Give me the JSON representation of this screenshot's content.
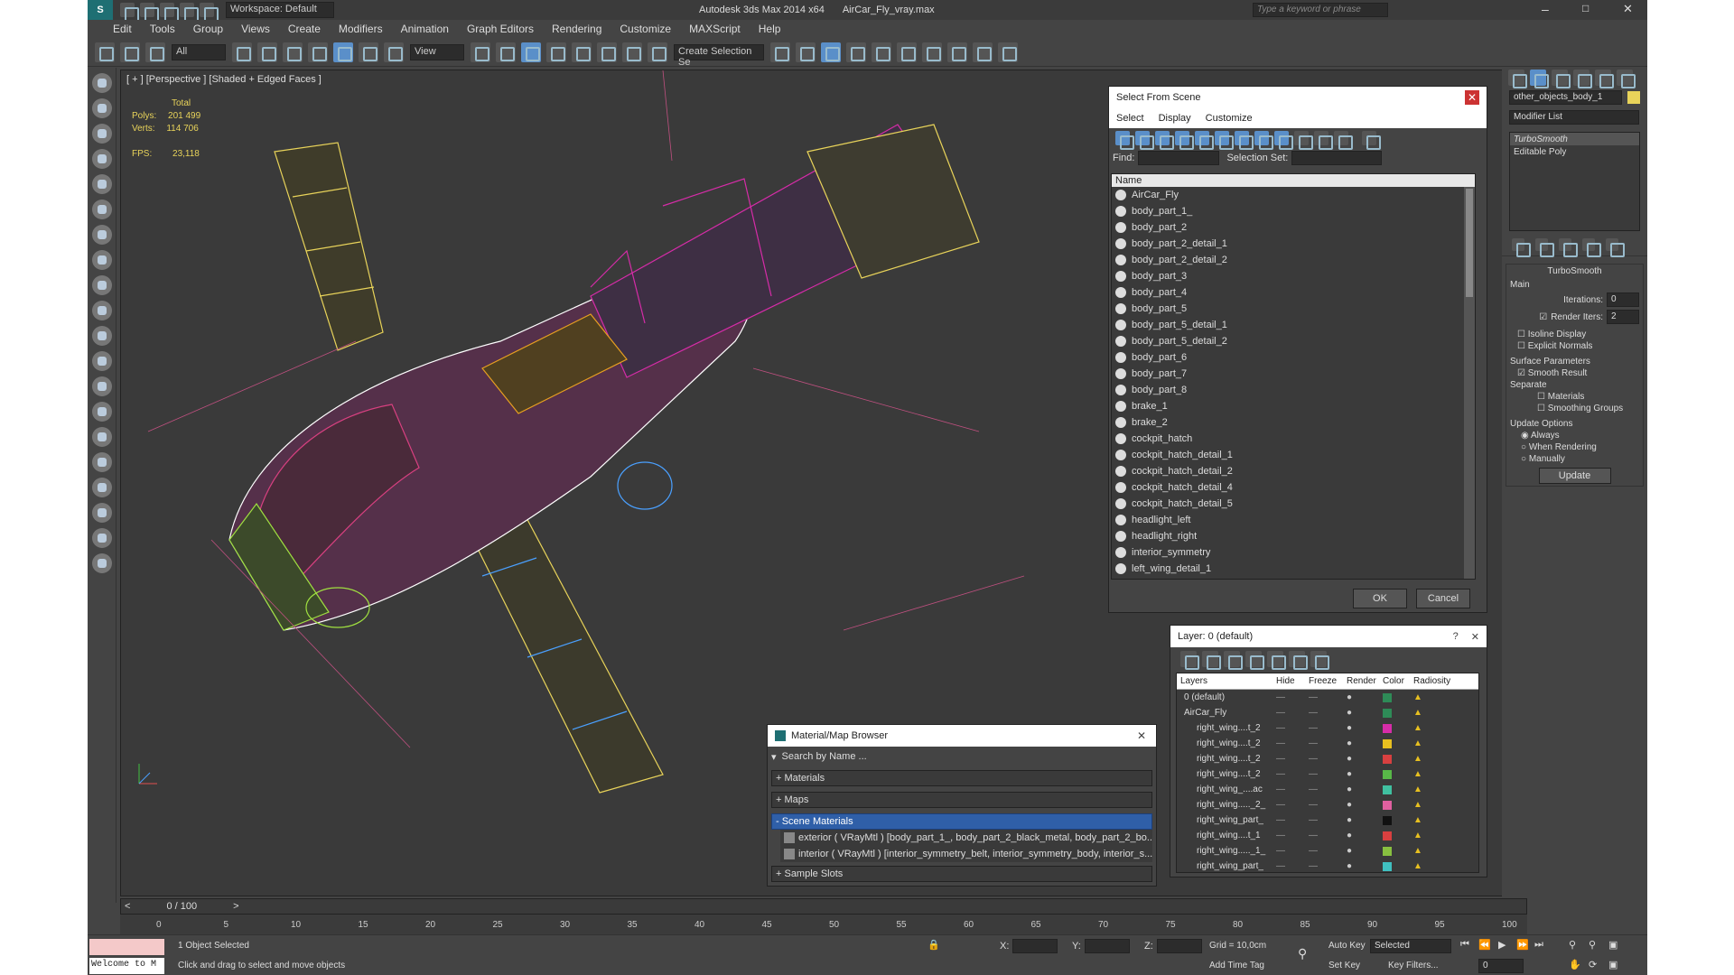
{
  "titlebar": {
    "workspace": "Workspace: Default",
    "app_title": "Autodesk 3ds Max  2014 x64",
    "file_title": "AirCar_Fly_vray.max",
    "search_placeholder": "Type a keyword or phrase"
  },
  "menu": [
    "Edit",
    "Tools",
    "Group",
    "Views",
    "Create",
    "Modifiers",
    "Animation",
    "Graph Editors",
    "Rendering",
    "Customize",
    "MAXScript",
    "Help"
  ],
  "toolbar": {
    "filter": "All",
    "view_mode": "View",
    "selection_set": "Create Selection Se"
  },
  "viewport": {
    "label": "[ + ] [Perspective ] [Shaded + Edged Faces ]",
    "stats_total": "Total",
    "polys_label": "Polys:",
    "polys_value": "201 499",
    "verts_label": "Verts:",
    "verts_value": "114 706",
    "fps_label": "FPS:",
    "fps_value": "23,118"
  },
  "select_scene": {
    "title": "Select From Scene",
    "menus": [
      "Select",
      "Display",
      "Customize"
    ],
    "find_label": "Find:",
    "selection_set_label": "Selection Set:",
    "column_name": "Name",
    "items": [
      "AirCar_Fly",
      "body_part_1_",
      "body_part_2",
      "body_part_2_detail_1",
      "body_part_2_detail_2",
      "body_part_3",
      "body_part_4",
      "body_part_5",
      "body_part_5_detail_1",
      "body_part_5_detail_2",
      "body_part_6",
      "body_part_7",
      "body_part_8",
      "brake_1",
      "brake_2",
      "cockpit_hatch",
      "cockpit_hatch_detail_1",
      "cockpit_hatch_detail_2",
      "cockpit_hatch_detail_4",
      "cockpit_hatch_detail_5",
      "headlight_left",
      "headlight_right",
      "interior_symmetry",
      "left_wing_detail_1"
    ],
    "ok": "OK",
    "cancel": "Cancel"
  },
  "layer_explorer": {
    "title": "Layer: 0 (default)",
    "help": "?",
    "columns": [
      "Layers",
      "Hide",
      "Freeze",
      "Render",
      "Color",
      "Radiosity"
    ],
    "rows": [
      {
        "name": "0 (default)",
        "color": "#2e8b57",
        "indent": 0
      },
      {
        "name": "AirCar_Fly",
        "color": "#2e8b57",
        "indent": 0
      },
      {
        "name": "right_wing....t_2",
        "color": "#d62ca8",
        "indent": 1
      },
      {
        "name": "right_wing....t_2",
        "color": "#e8c020",
        "indent": 1
      },
      {
        "name": "right_wing....t_2",
        "color": "#d84040",
        "indent": 1
      },
      {
        "name": "right_wing....t_2",
        "color": "#58b848",
        "indent": 1
      },
      {
        "name": "right_wing_....ac",
        "color": "#40c0a0",
        "indent": 1
      },
      {
        "name": "right_wing....._2_",
        "color": "#e060a0",
        "indent": 1
      },
      {
        "name": "right_wing_part_",
        "color": "#111111",
        "indent": 1
      },
      {
        "name": "right_wing....t_1",
        "color": "#d84040",
        "indent": 1
      },
      {
        "name": "right_wing....._1_",
        "color": "#88c040",
        "indent": 1
      },
      {
        "name": "right_wing_part_",
        "color": "#40c0c0",
        "indent": 1
      }
    ]
  },
  "material_browser": {
    "title": "Material/Map Browser",
    "search_placeholder": "Search by Name ...",
    "sections": [
      "+ Materials",
      "+ Maps",
      "- Scene Materials"
    ],
    "scene_materials": [
      "exterior ( VRayMtl ) [body_part_1_, body_part_2_black_metal, body_part_2_bo...",
      "interior ( VRayMtl ) [interior_symmetry_belt, interior_symmetry_body, interior_s..."
    ],
    "sample_slots": "+ Sample Slots"
  },
  "command_panel": {
    "object_name": "other_objects_body_1",
    "modifier_list": "Modifier List",
    "stack": [
      "TurboSmooth",
      "Editable Poly"
    ],
    "rollout_title": "TurboSmooth",
    "main_label": "Main",
    "iterations_label": "Iterations:",
    "iterations_value": "0",
    "render_iters_label": "Render Iters:",
    "render_iters_value": "2",
    "isoline_label": "Isoline Display",
    "explicit_label": "Explicit Normals",
    "surface_label": "Surface Parameters",
    "smooth_label": "Smooth Result",
    "separate_label": "Separate",
    "materials_label": "Materials",
    "smoothing_label": "Smoothing Groups",
    "update_label": "Update Options",
    "always_label": "Always",
    "when_rendering_label": "When Rendering",
    "manually_label": "Manually",
    "update_button": "Update"
  },
  "timeline": {
    "frame": "0 / 100",
    "ticks": [
      "0",
      "5",
      "10",
      "15",
      "20",
      "25",
      "30",
      "35",
      "40",
      "45",
      "50",
      "55",
      "60",
      "65",
      "70",
      "75",
      "80",
      "85",
      "90",
      "95",
      "100"
    ]
  },
  "status": {
    "maxscript": "Welcome to M",
    "selected": "1 Object Selected",
    "prompt": "Click and drag to select and move objects",
    "x_label": "X:",
    "y_label": "Y:",
    "z_label": "Z:",
    "grid": "Grid = 10,0cm",
    "add_time_tag": "Add Time Tag",
    "auto_key": "Auto Key",
    "set_key": "Set Key",
    "selected_dropdown": "Selected",
    "key_filters": "Key Filters...",
    "frame_value": "0"
  }
}
